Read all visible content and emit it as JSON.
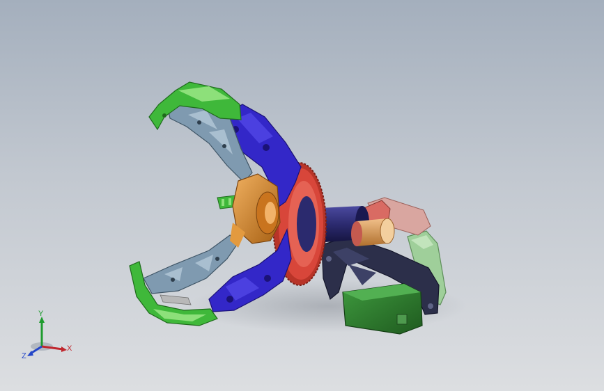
{
  "view": {
    "type": "3d-cad-viewport",
    "colors": {
      "bg_top": "#a4afbd",
      "bg_bottom": "#dcdee1",
      "finger_green": "#3fb83a",
      "finger_green_light": "#8de07a",
      "link_blue": "#3327c8",
      "link_blue_dark": "#1b1277",
      "plate_steel": "#7f9ab0",
      "hub_orange": "#d98a2b",
      "gear_red": "#d8463a",
      "drum_navy": "#2b2a6e",
      "bracket_dark": "#2c2f4a",
      "servo_green": "#2f7a2f",
      "mount_mint": "#9fcf9a",
      "bearing_salmon": "#d96b63",
      "bearing_tan": "#d9a070"
    },
    "parts": [
      {
        "name": "upper-finger",
        "color": "finger_green"
      },
      {
        "name": "lower-finger",
        "color": "finger_green"
      },
      {
        "name": "upper-link-arm",
        "color": "link_blue"
      },
      {
        "name": "lower-link-arm",
        "color": "link_blue"
      },
      {
        "name": "upper-truss-plate",
        "color": "plate_steel"
      },
      {
        "name": "lower-truss-plate",
        "color": "plate_steel"
      },
      {
        "name": "center-hub",
        "color": "hub_orange"
      },
      {
        "name": "spur-gear",
        "color": "gear_red"
      },
      {
        "name": "drive-drum",
        "color": "drum_navy"
      },
      {
        "name": "motor-bracket",
        "color": "bracket_dark"
      },
      {
        "name": "servo-motor",
        "color": "servo_green"
      },
      {
        "name": "motor-mount",
        "color": "mount_mint"
      },
      {
        "name": "bearing-block",
        "color": "bearing_salmon"
      }
    ]
  },
  "triad": {
    "x_label": "X",
    "y_label": "Y",
    "z_label": "Z",
    "x_color": "#c0262d",
    "y_color": "#1e9b2e",
    "z_color": "#2446c8"
  }
}
